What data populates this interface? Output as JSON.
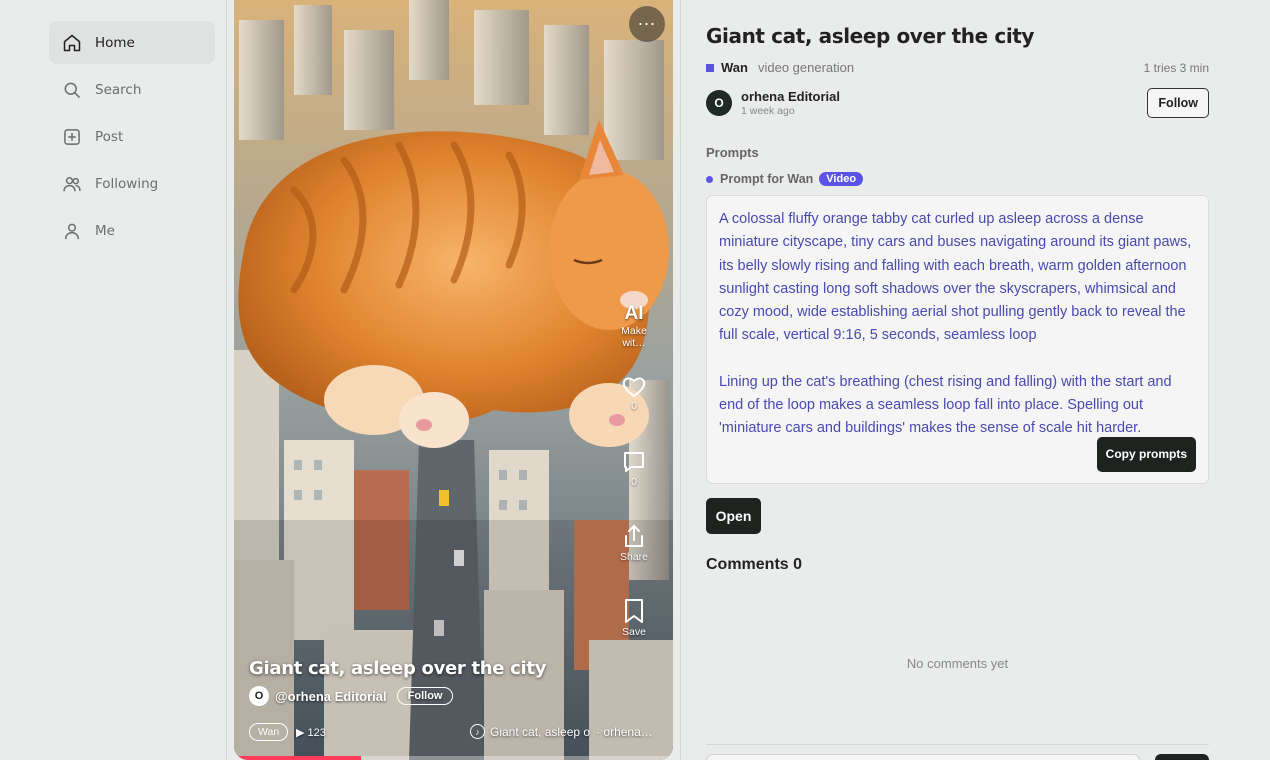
{
  "sidebar": {
    "items": [
      {
        "label": "Home",
        "icon": "home-icon",
        "active": true
      },
      {
        "label": "Search",
        "icon": "search-icon"
      },
      {
        "label": "Post",
        "icon": "plus-square-icon"
      },
      {
        "label": "Following",
        "icon": "users-icon"
      },
      {
        "label": "Me",
        "icon": "user-icon"
      }
    ]
  },
  "video": {
    "more": "⋯",
    "ai_label": "AI",
    "make_with": "Make wit…",
    "likes": "0",
    "comments": "0",
    "share_label": "Share",
    "save_label": "Save",
    "title": "Giant cat, asleep over the city",
    "author_initial": "O",
    "author_handle": "@orhena Editorial",
    "follow_label": "Follow",
    "tag": "Wan",
    "plays": "▶ 123",
    "music": "Giant cat, asleep o",
    "music_author": "· orhena…",
    "progress": 0.29
  },
  "detail": {
    "title": "Giant cat, asleep over the city",
    "model": "Wan",
    "model_type": "video generation",
    "meta": "1 tries 3 min",
    "author_initial": "O",
    "author_name": "orhena Editorial",
    "author_time": "1 week ago",
    "follow_label": "Follow",
    "prompts_heading": "Prompts",
    "prompt_for": "Prompt for Wan",
    "badge": "Video",
    "prompt_text": "A colossal fluffy orange tabby cat curled up asleep across a dense miniature cityscape, tiny cars and buses navigating around its giant paws, its belly slowly rising and falling with each breath, warm golden afternoon sunlight casting long soft shadows over the skyscrapers, whimsical and cozy mood, wide establishing aerial shot pulling gently back to reveal the full scale, vertical 9:16, 5 seconds, seamless loop",
    "prompt_tip": "Lining up the cat's breathing (chest rising and falling) with the start and end of the loop makes a seamless loop fall into place. Spelling out 'miniature cars and buildings' makes the sense of scale hit harder.",
    "copy_label": "Copy prompts",
    "open_label": "Open",
    "comments_heading": "Comments 0",
    "no_comments": "No comments yet"
  },
  "colors": {
    "accent": "#5b52e8",
    "dark_button": "#1e2320",
    "prompt_text": "#4a4ab0",
    "progress": "#ff3b5c"
  }
}
